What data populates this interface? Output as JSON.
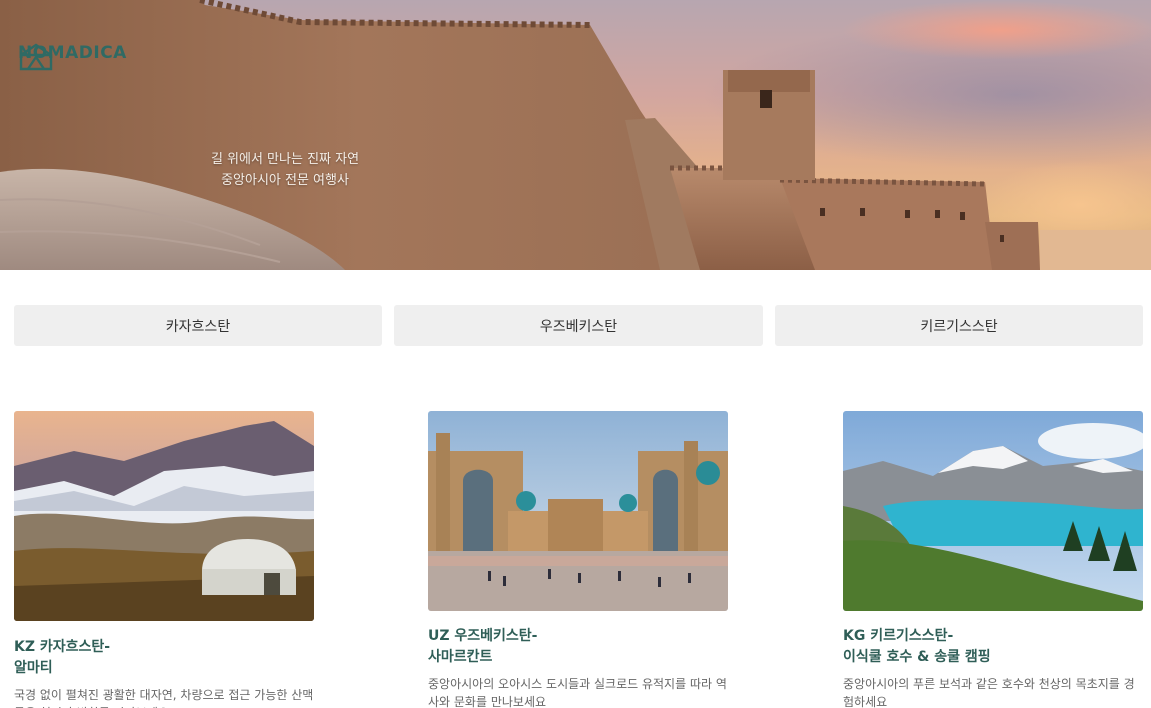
{
  "brand": {
    "name": "NOMADICA",
    "logo_icon": "yurt-logo-icon",
    "color": "#2f6a64"
  },
  "hero": {
    "tagline_line1": "길 위에서 만나는 진짜 자연",
    "tagline_line2": "중앙아시아 전문 여행사"
  },
  "tabs": [
    {
      "label": "카자흐스탄"
    },
    {
      "label": "우즈베키스탄"
    },
    {
      "label": "키르기스스탄"
    }
  ],
  "cards": [
    {
      "title_line1": "KZ 카자흐스탄-",
      "title_line2": "알마티",
      "desc": "국경 없이 펼쳐진 광활한 대자연, 차량으로 접근 가능한 산맥들을 현지가 방향를 만나보세요"
    },
    {
      "title_line1": "UZ 우즈베키스탄-",
      "title_line2": "사마르칸트",
      "desc": "중앙아시아의 오아시스 도시들과 실크로드 유적지를 따라 역사와 문화를 만나보세요"
    },
    {
      "title_line1": "KG 키르기스스탄-",
      "title_line2": "이식쿨 호수 & 송쿨 캠핑",
      "desc": "중앙아시아의 푸른 보석과 같은 호수와 천상의 목초지를 경험하세요"
    }
  ]
}
